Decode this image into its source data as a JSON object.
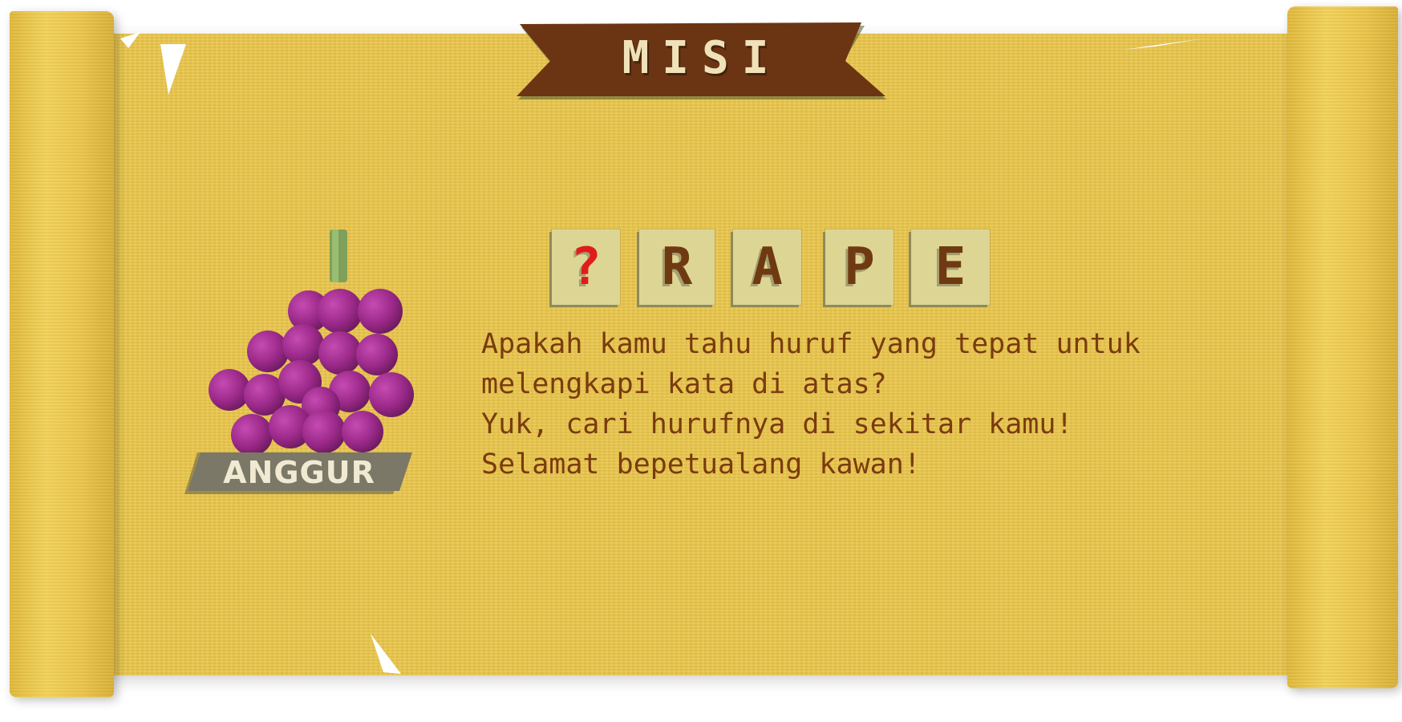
{
  "screen": "mission",
  "banner": {
    "title": "MISI"
  },
  "word_puzzle": {
    "tiles": [
      {
        "char": "?",
        "missing": true
      },
      {
        "char": "R",
        "missing": false
      },
      {
        "char": "A",
        "missing": false
      },
      {
        "char": "P",
        "missing": false
      },
      {
        "char": "E",
        "missing": false
      }
    ]
  },
  "description": {
    "lines": [
      "Apakah kamu tahu huruf yang tepat untuk",
      "melengkapi kata di atas?",
      "Yuk, cari hurufnya di sekitar kamu!",
      "Selamat bepetualang kawan!"
    ]
  },
  "fruit": {
    "name": "ANGGUR",
    "icon": "grapes-icon"
  },
  "colors": {
    "paper": "#e9c64c",
    "banner": "#6b3513",
    "banner_text": "#efe2b8",
    "tile": "#ddd594",
    "tile_text": "#6f3a12",
    "missing_letter": "#e11b1b",
    "body_text": "#7a3b0e",
    "label_plate": "#7b7867",
    "grape": "#9c2a8a"
  }
}
